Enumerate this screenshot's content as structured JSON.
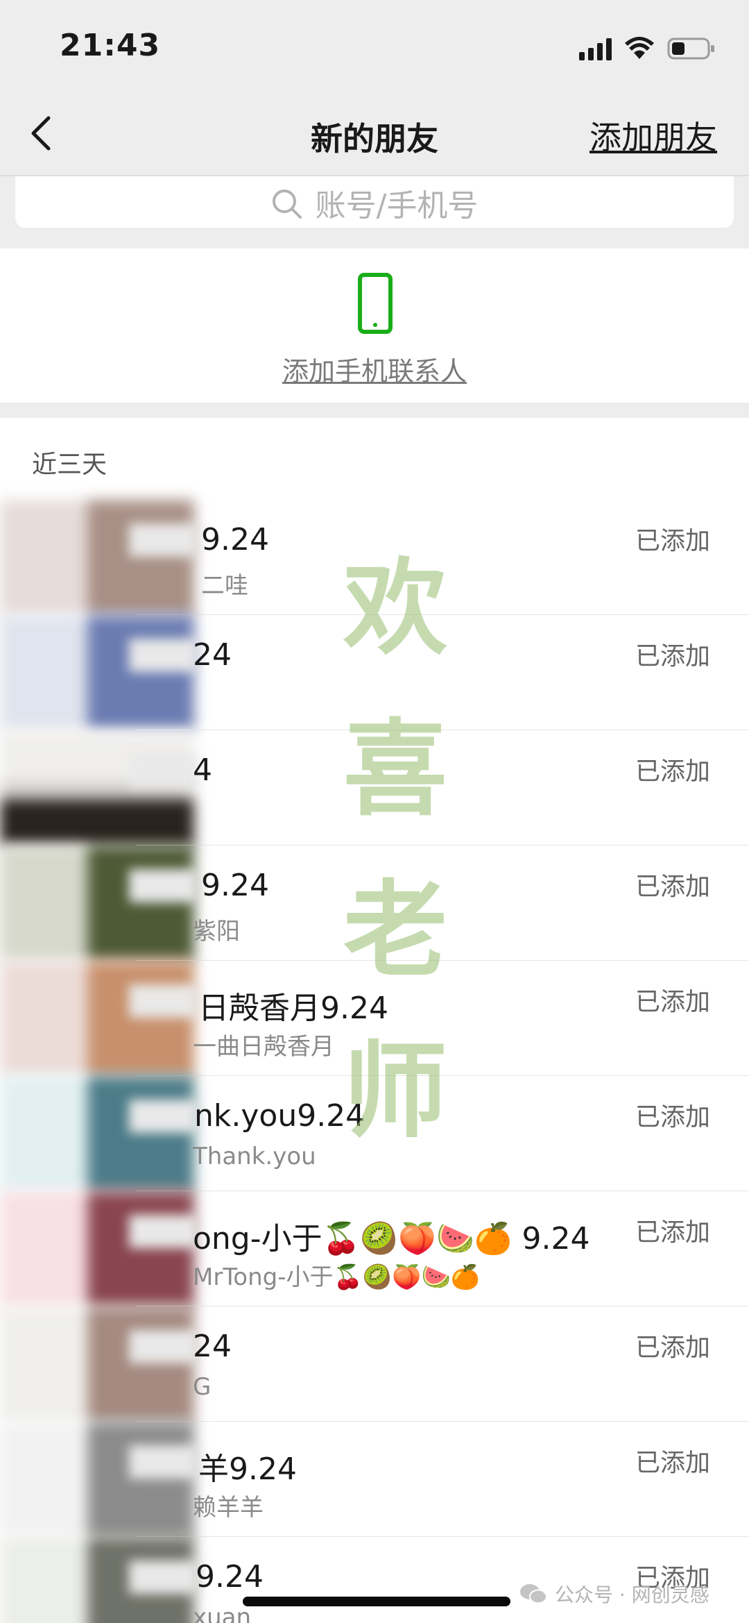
{
  "status_bar": {
    "time": "21:43",
    "icons": [
      "cellular-signal-icon",
      "wifi-icon",
      "battery-icon"
    ]
  },
  "nav": {
    "back_icon": "chevron-left-icon",
    "title": "新的朋友",
    "action": "添加朋友"
  },
  "search": {
    "icon": "search-icon",
    "placeholder": "账号/手机号"
  },
  "phone_contacts": {
    "icon": "smartphone-icon",
    "label": "添加手机联系人",
    "accent": "#1aad19"
  },
  "section": {
    "label": "近三天"
  },
  "contacts": [
    {
      "name": "9.24",
      "sub": "二哇",
      "status": "已添加"
    },
    {
      "name": "24",
      "sub": "",
      "status": "已添加"
    },
    {
      "name": "4",
      "sub": "",
      "status": "已添加"
    },
    {
      "name": "9.24",
      "sub": "紫阳",
      "status": "已添加"
    },
    {
      "name": "日殸香月9.24",
      "sub": "一曲日殸香月",
      "status": "已添加"
    },
    {
      "name": "nk.you9.24",
      "sub": "Thank.you",
      "status": "已添加"
    },
    {
      "name": "ong-小于🍒🥝🍑🍉🍊 9.24",
      "sub": "MrTong-小于🍒🥝🍑🍉🍊",
      "status": "已添加"
    },
    {
      "name": "24",
      "sub": "G",
      "status": "已添加"
    },
    {
      "name": "羊9.24",
      "sub": "赖羊羊",
      "status": "已添加"
    },
    {
      "name": "9.24",
      "sub": "xuan",
      "status": "已添加"
    }
  ],
  "watermark": {
    "lines": [
      "欢",
      "喜",
      "老",
      "师"
    ]
  },
  "footer": {
    "credit": "公众号 · 网创灵感"
  }
}
